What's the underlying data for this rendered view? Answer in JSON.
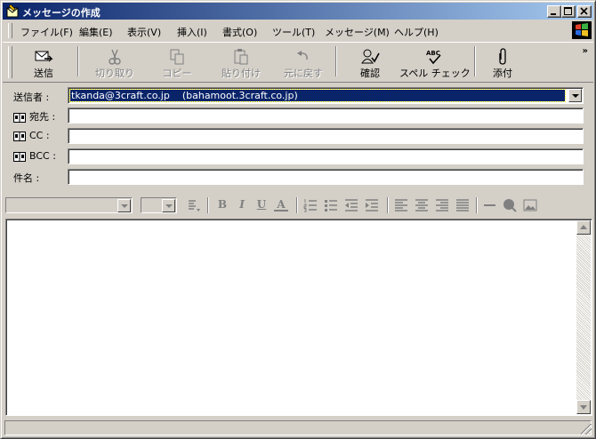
{
  "window": {
    "title": "メッセージの作成"
  },
  "menu": [
    "ファイル(F)",
    "編集(E)",
    "表示(V)",
    "挿入(I)",
    "書式(O)",
    "ツール(T)",
    "メッセージ(M)",
    "ヘルプ(H)"
  ],
  "toolbar": {
    "send": "送信",
    "cut": "切り取り",
    "copy": "コピー",
    "paste": "貼り付け",
    "undo": "元に戻す",
    "check": "確認",
    "spell": "スペル チェック",
    "attach": "添付",
    "spell_icon_text": "ABC",
    "more": "»"
  },
  "header": {
    "from_label": "送信者 :",
    "from_value": "tkanda@3craft.co.jp    (bahamoot.3craft.co.jp)",
    "to_label": "宛先 :",
    "cc_label": "CC :",
    "bcc_label": "BCC :",
    "subject_label": "件名 :",
    "to_value": "",
    "cc_value": "",
    "bcc_value": "",
    "subject_value": ""
  },
  "format": {
    "bold": "B",
    "italic": "I",
    "underline": "U",
    "color": "A"
  },
  "body": {
    "text": ""
  },
  "status": {
    "text": ""
  }
}
